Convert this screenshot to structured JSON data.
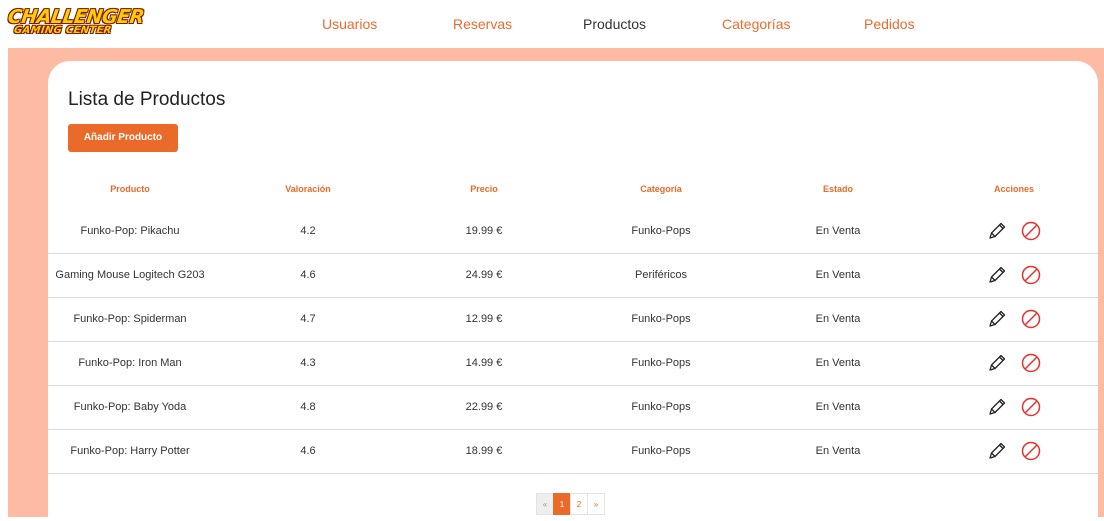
{
  "brand": {
    "logo_line1": "CHALLENGER",
    "logo_line2": "GAMING CENTER"
  },
  "nav": {
    "items": [
      {
        "label": "Usuarios"
      },
      {
        "label": "Reservas"
      },
      {
        "label": "Productos"
      },
      {
        "label": "Categorías"
      },
      {
        "label": "Pedidos"
      }
    ],
    "active": "Productos"
  },
  "page": {
    "title": "Lista de Productos",
    "add_button": "Añadir Producto"
  },
  "table": {
    "headers": [
      "Producto",
      "Valoración",
      "Precio",
      "Categoría",
      "Estado",
      "Acciones"
    ],
    "rows": [
      {
        "producto": "Funko-Pop: Pikachu",
        "valoracion": "4.2",
        "precio": "19.99 €",
        "categoria": "Funko-Pops",
        "estado": "En Venta"
      },
      {
        "producto": "Gaming Mouse Logitech G203",
        "valoracion": "4.6",
        "precio": "24.99 €",
        "categoria": "Periféricos",
        "estado": "En Venta"
      },
      {
        "producto": "Funko-Pop: Spiderman",
        "valoracion": "4.7",
        "precio": "12.99 €",
        "categoria": "Funko-Pops",
        "estado": "En Venta"
      },
      {
        "producto": "Funko-Pop: Iron Man",
        "valoracion": "4.3",
        "precio": "14.99 €",
        "categoria": "Funko-Pops",
        "estado": "En Venta"
      },
      {
        "producto": "Funko-Pop: Baby Yoda",
        "valoracion": "4.8",
        "precio": "22.99 €",
        "categoria": "Funko-Pops",
        "estado": "En Venta"
      },
      {
        "producto": "Funko-Pop: Harry Potter",
        "valoracion": "4.6",
        "precio": "18.99 €",
        "categoria": "Funko-Pops",
        "estado": "En Venta"
      }
    ],
    "action_icons": [
      "pencil-icon",
      "ban-icon"
    ]
  },
  "pagination": {
    "prev": "«",
    "pages": [
      "1",
      "2"
    ],
    "current": "1",
    "next": "»"
  },
  "colors": {
    "accent": "#ea6a2a",
    "band": "#fdbba3",
    "danger": "#e5322d"
  }
}
